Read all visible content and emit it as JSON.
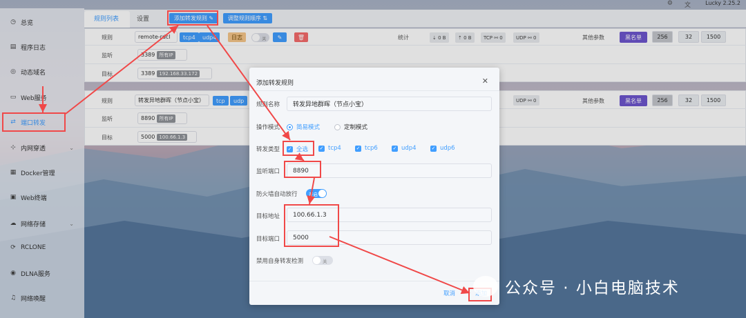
{
  "app": {
    "version": "Lucky 2.25.2"
  },
  "topbar": {
    "icon1": "gear-icon",
    "icon2": "translate-icon"
  },
  "sidebar": {
    "items": [
      {
        "label": "总览",
        "icon": "gauge-icon"
      },
      {
        "label": "程序日志",
        "icon": "log-icon"
      },
      {
        "label": "动态域名",
        "icon": "globe-icon"
      },
      {
        "label": "Web服务",
        "icon": "window-icon"
      },
      {
        "label": "端口转发",
        "icon": "swap-icon"
      },
      {
        "label": "内网穿透",
        "icon": "network-icon"
      },
      {
        "label": "Docker管理",
        "icon": "docker-icon"
      },
      {
        "label": "Web终端",
        "icon": "terminal-icon"
      },
      {
        "label": "网络存储",
        "icon": "cloud-icon"
      },
      {
        "label": "RCLONE",
        "icon": "sync-icon"
      },
      {
        "label": "DLNA服务",
        "icon": "cast-icon"
      },
      {
        "label": "网络唤醒",
        "icon": "bell-icon"
      }
    ],
    "active_index": 4
  },
  "tabs": {
    "rule_list": "规则列表",
    "settings": "设置",
    "add_rule": "添加转发规则",
    "reorder": "调整规则顺序"
  },
  "rules": [
    {
      "rule_label": "规则",
      "name": "remote-rdcl",
      "protocols": [
        "tcp4",
        "udp4"
      ],
      "log_btn": "日志",
      "switch_text": "关",
      "listen_label": "监听",
      "listen_port": "3389",
      "listen_tag": "所有IP",
      "target_label": "目标",
      "target_port": "3389",
      "target_ip": "192.168.33.172",
      "stats_label": "统计",
      "stats": [
        "⇣ 0 B",
        "⇡ 0 B",
        "TCP ⚯ 0",
        "UDP ⚯ 0"
      ],
      "other_label": "其他参数",
      "blacklist": "黑名单",
      "params": [
        "256",
        "32",
        "1500"
      ]
    },
    {
      "rule_label": "规则",
      "name": "转发异地群晖（节点小宝）",
      "protocols": [
        "tcp",
        "udp"
      ],
      "listen_label": "监听",
      "listen_port": "8890",
      "listen_tag": "所有IP",
      "target_label": "目标",
      "target_port": "5000",
      "target_ip": "100.66.1.3",
      "stats": [
        "UDP ⚯ 0"
      ],
      "other_label": "其他参数",
      "blacklist": "黑名单",
      "params": [
        "256",
        "32",
        "1500"
      ]
    }
  ],
  "dialog": {
    "title": "添加转发规则",
    "name_label": "规则名称",
    "name_value": "转发异地群晖（节点小宝）",
    "mode_label": "操作模式",
    "mode_simple": "简易模式",
    "mode_custom": "定制模式",
    "type_label": "转发类型",
    "types": [
      "全选",
      "tcp4",
      "tcp6",
      "udp4",
      "udp6"
    ],
    "listen_label": "监听端口",
    "listen_value": "8890",
    "firewall_label": "防火墙自动放行",
    "firewall_switch": "开启",
    "target_addr_label": "目标地址",
    "target_addr_value": "100.66.1.3",
    "target_port_label": "目标端口",
    "target_port_value": "5000",
    "disable_self_label": "禁用自身转发检测",
    "disable_self_switch": "关",
    "cancel": "取消",
    "submit": "添加"
  },
  "watermark": "公众号 · 小白电脑技术",
  "colors": {
    "accent": "#409eff",
    "annotation": "#f04848",
    "blacklist": "#6e56cf"
  }
}
